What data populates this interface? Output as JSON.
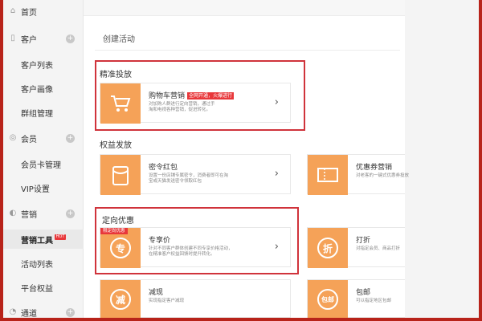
{
  "sidebar": {
    "home": "首页",
    "customers": "客户",
    "customer_list": "客户列表",
    "customer_profile": "客户画像",
    "group_mgmt": "群组管理",
    "members": "会员",
    "member_card": "会员卡管理",
    "vip_settings": "VIP设置",
    "marketing": "营销",
    "marketing_tools": "营销工具",
    "hot_badge": "HOT",
    "activity_list": "活动列表",
    "platform_rights": "平台权益",
    "channels": "通道"
  },
  "main": {
    "page_title": "创建活动",
    "precise": {
      "section_title": "精准投放",
      "card_title": "购物车营销",
      "card_tag": "全网开通，火爆进行",
      "card_desc1": "对加购人群进行定向营销，通过手",
      "card_desc2": "淘和电视各种营销，促进转化。"
    },
    "rights": {
      "section_title": "权益发放",
      "card1_title": "密令红包",
      "card1_desc1": "设置一份店铺专属密令，消费者即可在淘",
      "card1_desc2": "宝或天猫发送密令领取红包",
      "card2_title": "优惠券营销",
      "card2_desc1": "对老客的一键式优惠券投放"
    },
    "targeted": {
      "section_title": "定向优惠",
      "card1_title": "专享价",
      "card1_corner": "限定尚优惠",
      "card1_desc1": "针对不同客户群体创建不同专享价格活动，",
      "card1_desc2": "在精准客户权益回馈时提升转化。",
      "card1_icon": "专",
      "card2_title": "打折",
      "card2_desc1": "对指定会员、商品打折",
      "card2_icon": "折"
    },
    "more": {
      "card1_title": "减现",
      "card1_desc1": "实现指定客户减现",
      "card1_icon": "减",
      "card2_title": "包邮",
      "card2_desc1": "可以指定地区包邮",
      "card2_icon": "包邮"
    },
    "arrow_glyph": "›",
    "plus_glyph": "+"
  },
  "colors": {
    "accent": "#f5a258",
    "red": "#d0333b",
    "frame": "#b8231a"
  }
}
